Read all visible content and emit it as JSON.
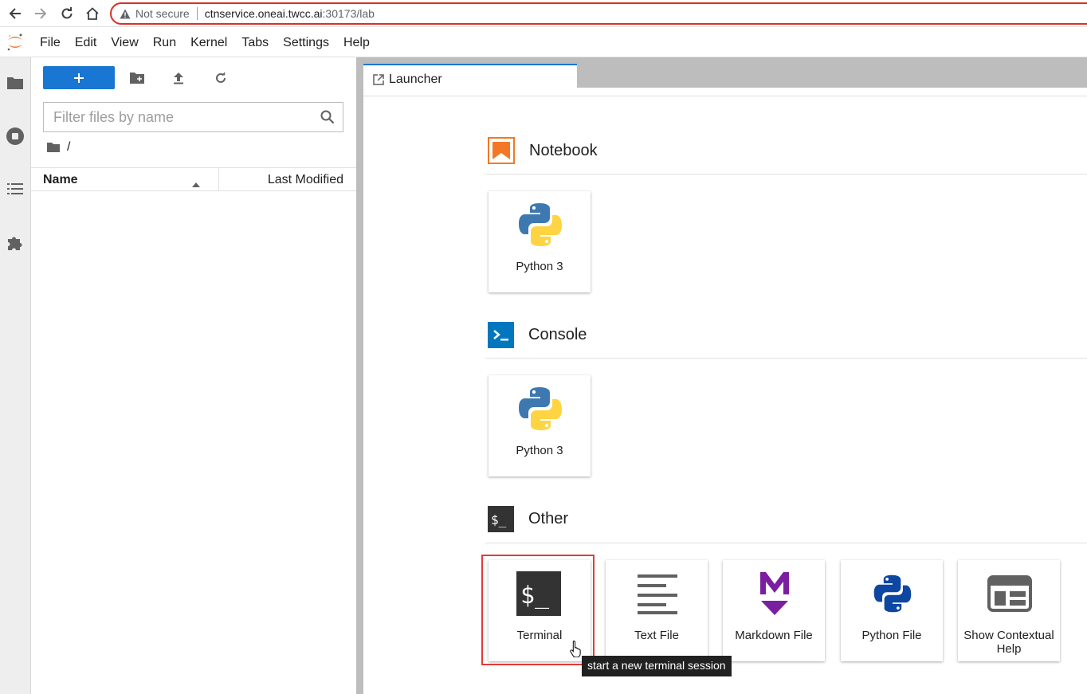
{
  "browser": {
    "security_label": "Not secure",
    "url_host": "ctnservice.oneai.twcc.ai",
    "url_path": ":30173/lab"
  },
  "menu": {
    "items": [
      "File",
      "Edit",
      "View",
      "Run",
      "Kernel",
      "Tabs",
      "Settings",
      "Help"
    ]
  },
  "filebrowser": {
    "filter_placeholder": "Filter files by name",
    "path": "/",
    "columns": {
      "name": "Name",
      "modified": "Last Modified"
    }
  },
  "tabs": [
    {
      "label": "Launcher"
    }
  ],
  "launcher": {
    "sections": [
      {
        "title": "Notebook",
        "cards": [
          {
            "label": "Python 3",
            "icon": "python-logo-icon"
          }
        ]
      },
      {
        "title": "Console",
        "cards": [
          {
            "label": "Python 3",
            "icon": "python-logo-icon"
          }
        ]
      },
      {
        "title": "Other",
        "cards": [
          {
            "label": "Terminal",
            "icon": "terminal-icon"
          },
          {
            "label": "Text File",
            "icon": "text-file-icon"
          },
          {
            "label": "Markdown File",
            "icon": "markdown-icon"
          },
          {
            "label": "Python File",
            "icon": "python-file-icon"
          },
          {
            "label": "Show Contextual Help",
            "icon": "contextual-help-icon"
          }
        ]
      }
    ],
    "tooltip": "start a new terminal session"
  },
  "colors": {
    "accent": "#1976d2",
    "notebook": "#f37726",
    "console": "#0277bd",
    "markdown": "#7b1fa2",
    "python_blue": "#0d47a1",
    "highlight": "#e53935"
  }
}
